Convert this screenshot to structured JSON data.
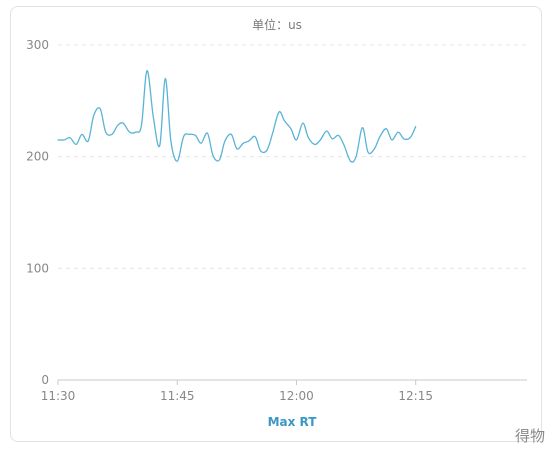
{
  "chart_data": {
    "type": "line",
    "unit_label": "单位：us",
    "legend": "Max RT",
    "ylim": [
      0,
      300
    ],
    "y_ticks": [
      "0",
      "100",
      "200",
      "300"
    ],
    "x_ticks": [
      {
        "label": "11:30",
        "minute": 0
      },
      {
        "label": "11:45",
        "minute": 15
      },
      {
        "label": "12:00",
        "minute": 30
      },
      {
        "label": "12:15",
        "minute": 45
      }
    ],
    "x_range_minutes": [
      0,
      59
    ],
    "grid": "dashed horizontal",
    "colors": {
      "line": "#5ab3d6",
      "legend": "#3b97c4",
      "grid": "#e6e6e6",
      "axis": "#c9c9c9",
      "tick_text": "#888888"
    },
    "series": [
      {
        "name": "Max RT",
        "points": [
          [
            0.0,
            215
          ],
          [
            0.8,
            215
          ],
          [
            1.5,
            217
          ],
          [
            2.3,
            211
          ],
          [
            3.0,
            220
          ],
          [
            3.8,
            214
          ],
          [
            4.5,
            237
          ],
          [
            5.3,
            243
          ],
          [
            6.0,
            222
          ],
          [
            6.8,
            220
          ],
          [
            7.5,
            228
          ],
          [
            8.2,
            230
          ],
          [
            9.0,
            222
          ],
          [
            9.8,
            222
          ],
          [
            10.5,
            228
          ],
          [
            11.2,
            277
          ],
          [
            12.0,
            235
          ],
          [
            12.8,
            210
          ],
          [
            13.5,
            270
          ],
          [
            14.2,
            214
          ],
          [
            15.0,
            196
          ],
          [
            15.8,
            218
          ],
          [
            16.5,
            220
          ],
          [
            17.3,
            219
          ],
          [
            18.0,
            212
          ],
          [
            18.8,
            221
          ],
          [
            19.5,
            201
          ],
          [
            20.3,
            197
          ],
          [
            21.0,
            214
          ],
          [
            21.8,
            220
          ],
          [
            22.5,
            207
          ],
          [
            23.3,
            212
          ],
          [
            24.0,
            214
          ],
          [
            24.8,
            218
          ],
          [
            25.5,
            205
          ],
          [
            26.3,
            206
          ],
          [
            27.0,
            221
          ],
          [
            27.8,
            240
          ],
          [
            28.5,
            232
          ],
          [
            29.3,
            225
          ],
          [
            30.0,
            215
          ],
          [
            30.8,
            230
          ],
          [
            31.5,
            217
          ],
          [
            32.3,
            211
          ],
          [
            33.0,
            215
          ],
          [
            33.8,
            223
          ],
          [
            34.5,
            216
          ],
          [
            35.3,
            219
          ],
          [
            36.0,
            210
          ],
          [
            36.8,
            196
          ],
          [
            37.5,
            200
          ],
          [
            38.3,
            226
          ],
          [
            39.0,
            204
          ],
          [
            39.8,
            207
          ],
          [
            40.5,
            218
          ],
          [
            41.3,
            225
          ],
          [
            42.0,
            215
          ],
          [
            42.8,
            222
          ],
          [
            43.5,
            216
          ],
          [
            44.3,
            217
          ],
          [
            45.0,
            227
          ]
        ]
      }
    ]
  }
}
